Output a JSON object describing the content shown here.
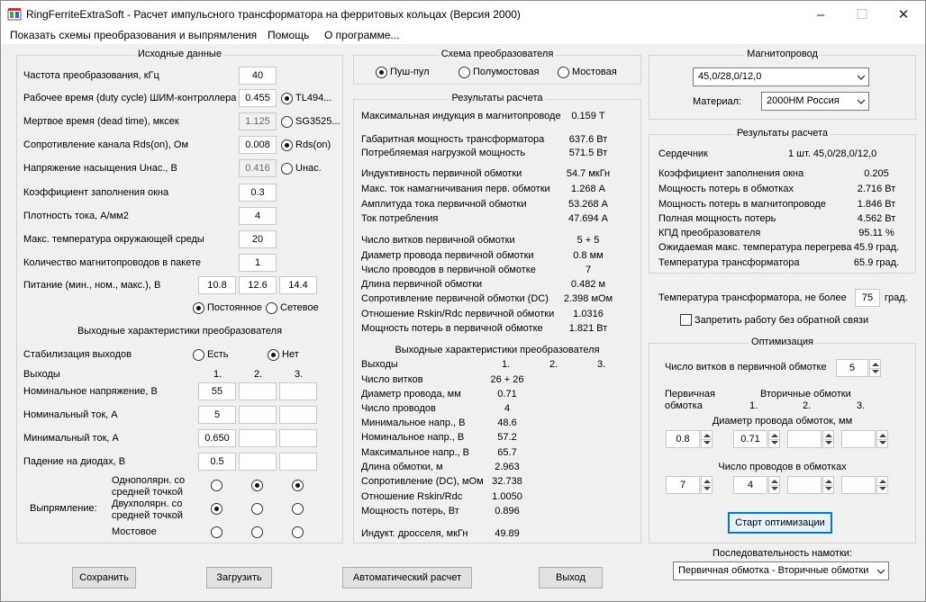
{
  "window": {
    "title": "RingFerriteExtraSoft - Расчет импульсного трансформатора на ферритовых кольцах (Версия 2000)",
    "minimize": "–",
    "maximize": "☐",
    "close": "✕"
  },
  "menu": [
    "Показать схемы преобразования и выпрямления",
    "Помощь",
    "О программе..."
  ],
  "input": {
    "title": "Исходные данные",
    "freq_label": "Частота преобразования, кГц",
    "freq": "40",
    "duty_label": "Рабочее время (duty cycle) ШИМ-контроллера",
    "duty": "0.455",
    "tl494": "TL494...",
    "dead_label": "Мертвое время (dead time), мксек",
    "dead": "1.125",
    "sg3525": "SG3525...",
    "rds_label": "Сопротивление канала Rds(on), Ом",
    "rds": "0.008",
    "rds_radio": "Rds(on)",
    "unas_label": "Напряжение насыщения Uнас., В",
    "unas": "0.416",
    "unas_radio": "Uнас.",
    "fill_label": "Коэффициент заполнения окна",
    "fill": "0.3",
    "density_label": "Плотность тока, А/мм2",
    "density": "4",
    "temp_label": "Макс. температура окружающей среды",
    "temp": "20",
    "count_label": "Количество магнитопроводов  в пакете",
    "count": "1",
    "supply_label": "Питание (мин., ном., макс.), В",
    "supply_min": "10.8",
    "supply_nom": "12.6",
    "supply_max": "14.4",
    "dc": "Постоянное",
    "ac": "Сетевое"
  },
  "output": {
    "title": "Выходные характеристики преобразователя",
    "stab_label": "Стабилизация выходов",
    "stab_yes": "Есть",
    "stab_no": "Нет",
    "outputs_label": "Выходы",
    "col1": "1.",
    "col2": "2.",
    "col3": "3.",
    "vnom_label": "Номинальное напряжение, В",
    "vnom1": "55",
    "inom_label": "Номинальный ток, А",
    "inom1": "5",
    "imin_label": "Минимальный ток, А",
    "imin1": "0.650",
    "diode_label": "Падение на диодах, В",
    "diode1": "0.5",
    "rect_label": "Выпрямление:",
    "rect_opt1": "Однополярн. со средней точкой",
    "rect_opt2": "Двухполярн. со средней точкой",
    "rect_opt3": "Мостовое"
  },
  "scheme": {
    "title": "Схема преобразователя",
    "opt1": "Пуш-пул",
    "opt2": "Полумостовая",
    "opt3": "Мостовая"
  },
  "results": {
    "title": "Результаты расчета",
    "rows": [
      {
        "l": "Максимальная индукция в магнитопроводе",
        "v": "0.159 Т"
      },
      {
        "l": "Габаритная мощность трансформатора",
        "v": "637.6 Вт"
      },
      {
        "l": "Потребляемая нагрузкой мощность",
        "v": "571.5 Вт"
      },
      {
        "l": "Индуктивность первичной обмотки",
        "v": "54.7 мкГн"
      },
      {
        "l": "Макс. ток намагничивания перв. обмотки",
        "v": "1.268 А"
      },
      {
        "l": "Амплитуда тока первичной обмотки",
        "v": "53.268 А"
      },
      {
        "l": "Ток потребления",
        "v": "47.694 А"
      },
      {
        "l": "Число витков первичной обмотки",
        "v": "5 + 5"
      },
      {
        "l": "Диаметр провода первичной обмотки",
        "v": "0.8 мм"
      },
      {
        "l": "Число проводов в первичной обмотке",
        "v": "7"
      },
      {
        "l": "Длина  первичной обмотки",
        "v": "0.482 м"
      },
      {
        "l": "Сопротивление первичной обмотки (DC)",
        "v": "2.398 мОм"
      },
      {
        "l": "Отношение Rskin/Rdc первичной обмотки",
        "v": "1.0316"
      },
      {
        "l": "Мощность потерь в первичной обмотке",
        "v": "1.821 Вт"
      }
    ]
  },
  "results_out": {
    "title": "Выходные характеристики преобразователя",
    "outputs": "Выходы",
    "c1": "1.",
    "c2": "2.",
    "c3": "3.",
    "rows": [
      {
        "l": "Число витков",
        "v": "26 + 26"
      },
      {
        "l": "Диаметр провода, мм",
        "v": "0.71"
      },
      {
        "l": "Число проводов",
        "v": "4"
      },
      {
        "l": "Минимальное напр., В",
        "v": "48.6"
      },
      {
        "l": "Номинальное напр., В",
        "v": "57.2"
      },
      {
        "l": "Максимальное напр., В",
        "v": "65.7"
      },
      {
        "l": "Длина обмотки, м",
        "v": "2.963"
      },
      {
        "l": "Сопротивление (DC), мОм",
        "v": "32.738"
      },
      {
        "l": "Отношение Rskin/Rdc",
        "v": "1.0050"
      },
      {
        "l": "Мощность потерь, Вт",
        "v": "0.896"
      }
    ],
    "choke_label": "Индукт. дросселя, мкГн",
    "choke": "49.89"
  },
  "core": {
    "title": "Магнитопровод",
    "size": "45,0/28,0/12,0",
    "material_label": "Материал:",
    "material": "2000НМ Россия"
  },
  "core_results": {
    "title": "Результаты расчета",
    "core_label": "Сердечник",
    "core_value": "1 шт. 45,0/28,0/12,0",
    "rows": [
      {
        "l": "Коэффициент заполнения окна",
        "v": "0.205"
      },
      {
        "l": "Мощность потерь в обмотках",
        "v": "2.716 Вт"
      },
      {
        "l": "Мощность потерь в магнитопроводе",
        "v": "1.846 Вт"
      },
      {
        "l": "Полная мощность потерь",
        "v": "4.562 Вт"
      },
      {
        "l": "КПД преобразователя",
        "v": "95.11 %"
      },
      {
        "l": "Ожидаемая макс. температура перегрева",
        "v": "45.9 град."
      },
      {
        "l": "Температура трансформатора",
        "v": "65.9 град."
      }
    ]
  },
  "temp_limit": {
    "label": "Температура трансформатора, не более",
    "value": "75",
    "unit": "град."
  },
  "no_feedback": "Запретить работу без обратной связи",
  "optim": {
    "title": "Оптимизация",
    "turns_label": "Число витков в первичной обмотке",
    "turns": "5",
    "primary": "Первичная обмотка",
    "secondary": "Вторичные обмотки",
    "s1": "1.",
    "s2": "2.",
    "s3": "3.",
    "diam_label": "Диаметр провода обмоток, мм",
    "diam_p": "0.8",
    "diam_s1": "0.71",
    "wires_label": "Число проводов в обмотках",
    "wires_p": "7",
    "wires_s1": "4",
    "start": "Старт оптимизации"
  },
  "winding_order": {
    "label": "Последовательность намотки:",
    "value": "Первичная обмотка - Вторичные обмотки"
  },
  "buttons": {
    "save": "Сохранить",
    "load": "Загрузить",
    "auto": "Автоматический расчет",
    "exit": "Выход"
  }
}
